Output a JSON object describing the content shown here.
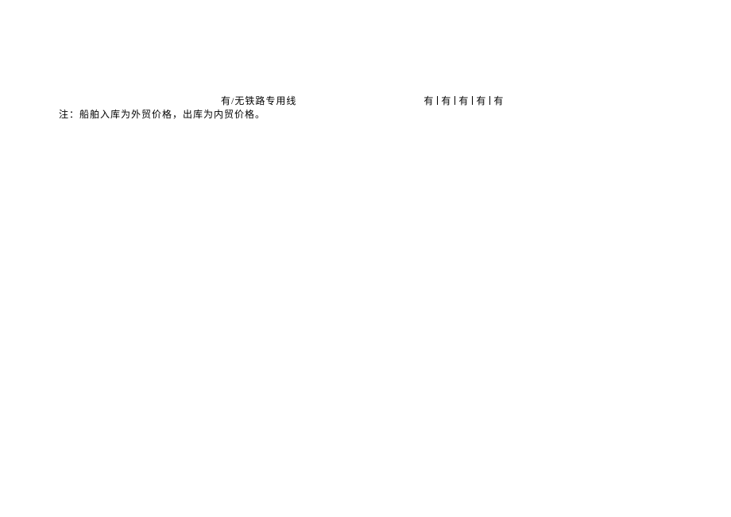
{
  "row": {
    "label": "有/无铁路专用线",
    "values": [
      "有",
      "有",
      "有",
      "有",
      "有"
    ]
  },
  "note": "注：船舶入库为外贸价格，出库为内贸价格。"
}
